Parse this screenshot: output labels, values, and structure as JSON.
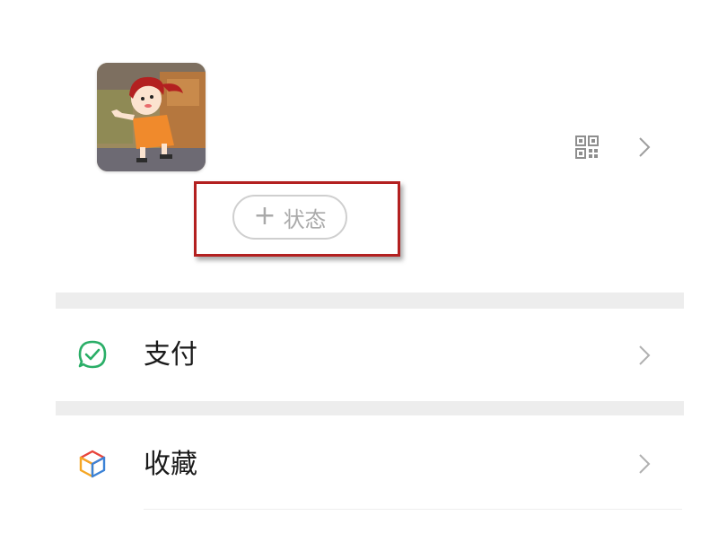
{
  "profile": {
    "avatar_icon": "cartoon-avatar",
    "qr_icon": "qr-code-icon",
    "chevron_icon": "chevron-right-icon",
    "status_button": {
      "plus": "+",
      "label": "状态"
    },
    "highlight_color": "#b32020"
  },
  "menu": {
    "items": [
      {
        "label": "支付",
        "icon": "pay-check-icon",
        "icon_color": "#2aae67"
      },
      {
        "label": "收藏",
        "icon": "favorites-cube-icon",
        "icon_color": "#f5a623"
      }
    ]
  },
  "colors": {
    "background": "#ffffff",
    "separator": "#ededed",
    "text": "#1a1a1a",
    "muted": "#aaaaaa"
  }
}
